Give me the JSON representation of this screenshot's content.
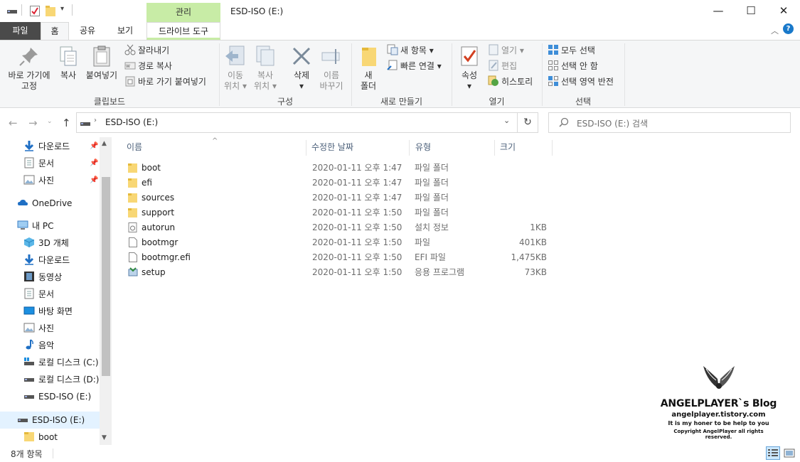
{
  "window": {
    "title": "ESD-ISO (E:)",
    "context_tab": "관리",
    "minimize": "—",
    "maximize": "☐",
    "close": "✕"
  },
  "ribbon_tabs": {
    "file": "파일",
    "home": "홈",
    "share": "공유",
    "view": "보기",
    "drive_tools": "드라이브 도구"
  },
  "ribbon": {
    "clipboard": {
      "label": "클립보드",
      "pin_line1": "바로 가기에",
      "pin_line2": "고정",
      "copy": "복사",
      "paste": "붙여넣기",
      "cut": "잘라내기",
      "copy_path": "경로 복사",
      "paste_shortcut": "바로 가기 붙여넣기"
    },
    "organize": {
      "label": "구성",
      "move_line1": "이동",
      "move_line2": "위치",
      "copy_line1": "복사",
      "copy_line2": "위치",
      "delete": "삭제",
      "rename_line1": "이름",
      "rename_line2": "바꾸기"
    },
    "new": {
      "label": "새로 만들기",
      "folder_line1": "새",
      "folder_line2": "폴더",
      "new_item": "새 항목",
      "easy_access": "빠른 연결"
    },
    "open": {
      "label": "열기",
      "properties": "속성",
      "open": "열기",
      "edit": "편집",
      "history": "히스토리"
    },
    "select": {
      "label": "선택",
      "select_all": "모두 선택",
      "select_none": "선택 안 함",
      "invert": "선택 영역 반전"
    }
  },
  "address": {
    "path": "ESD-ISO (E:)",
    "search_placeholder": "ESD-ISO (E:) 검색"
  },
  "nav": {
    "quick": [
      {
        "label": "다운로드",
        "icon": "download-icon"
      },
      {
        "label": "문서",
        "icon": "document-icon"
      },
      {
        "label": "사진",
        "icon": "pictures-icon"
      }
    ],
    "onedrive": "OneDrive",
    "this_pc": "내 PC",
    "pc_items": [
      {
        "label": "3D 개체",
        "icon": "3d-objects-icon"
      },
      {
        "label": "다운로드",
        "icon": "download-icon"
      },
      {
        "label": "동영상",
        "icon": "video-icon"
      },
      {
        "label": "문서",
        "icon": "document-icon"
      },
      {
        "label": "바탕 화면",
        "icon": "desktop-icon"
      },
      {
        "label": "사진",
        "icon": "pictures-icon"
      },
      {
        "label": "음악",
        "icon": "music-icon"
      },
      {
        "label": "로컬 디스크 (C:)",
        "icon": "local-disk-icon"
      },
      {
        "label": "로컬 디스크 (D:)",
        "icon": "drive-icon"
      },
      {
        "label": "ESD-ISO (E:)",
        "icon": "drive-icon"
      }
    ],
    "selected": "ESD-ISO (E:)",
    "sub_item": "boot"
  },
  "columns": {
    "name": "이름",
    "date": "수정한 날짜",
    "type": "유형",
    "size": "크기"
  },
  "files": [
    {
      "name": "boot",
      "date": "2020-01-11 오후 1:47",
      "type": "파일 폴더",
      "size": "",
      "icon": "folder-icon"
    },
    {
      "name": "efi",
      "date": "2020-01-11 오후 1:47",
      "type": "파일 폴더",
      "size": "",
      "icon": "folder-icon"
    },
    {
      "name": "sources",
      "date": "2020-01-11 오후 1:47",
      "type": "파일 폴더",
      "size": "",
      "icon": "folder-icon"
    },
    {
      "name": "support",
      "date": "2020-01-11 오후 1:50",
      "type": "파일 폴더",
      "size": "",
      "icon": "folder-icon"
    },
    {
      "name": "autorun",
      "date": "2020-01-11 오후 1:50",
      "type": "설치 정보",
      "size": "1KB",
      "icon": "setup-info-icon"
    },
    {
      "name": "bootmgr",
      "date": "2020-01-11 오후 1:50",
      "type": "파일",
      "size": "401KB",
      "icon": "file-icon"
    },
    {
      "name": "bootmgr.efi",
      "date": "2020-01-11 오후 1:50",
      "type": "EFI 파일",
      "size": "1,475KB",
      "icon": "file-icon"
    },
    {
      "name": "setup",
      "date": "2020-01-11 오후 1:50",
      "type": "응용 프로그램",
      "size": "73KB",
      "icon": "setup-app-icon"
    }
  ],
  "watermark": {
    "title": "ANGELPLAYER`s Blog",
    "url": "angelplayer.tistory.com",
    "line1": "It is my honer to be help to you",
    "line2": "Copyright AngelPlayer all rights reserved."
  },
  "status": {
    "count": "8개 항목"
  },
  "colors": {
    "context_tab": "#c8eca6",
    "file_tab": "#4a4a4a",
    "selection": "#cce8ff",
    "folder": "#f8d775"
  }
}
